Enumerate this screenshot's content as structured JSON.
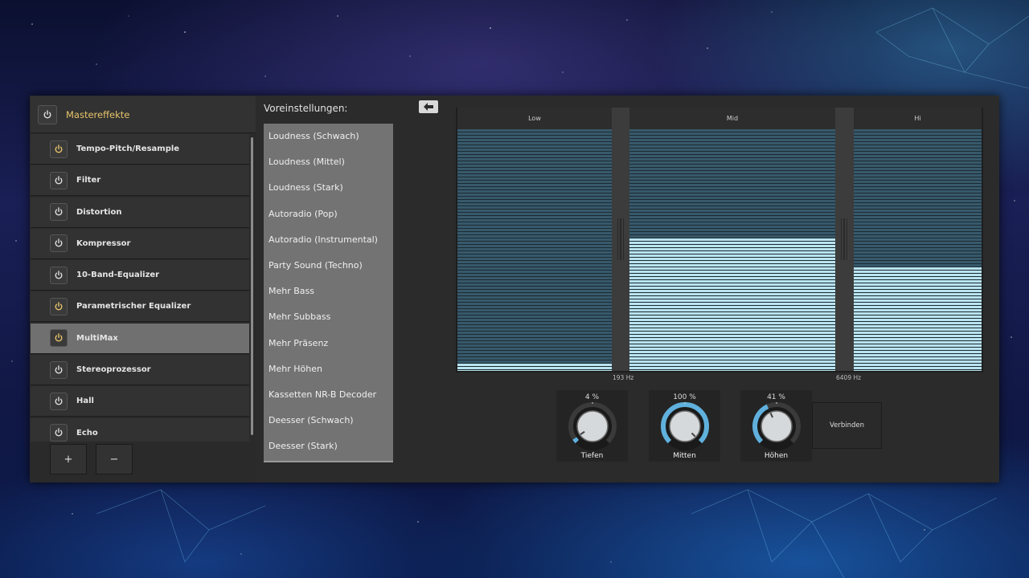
{
  "colors": {
    "accent": "#e7c46a",
    "band_active": "#b9e4f0",
    "band_inactive": "#37596b",
    "knob_ring": "#5fb0dd",
    "panel": "#2b2b2b"
  },
  "effects": {
    "title": "Mastereffekte",
    "items": [
      {
        "label": "Tempo-Pitch/Resample",
        "active": true,
        "selected": false
      },
      {
        "label": "Filter",
        "active": false,
        "selected": false
      },
      {
        "label": "Distortion",
        "active": false,
        "selected": false
      },
      {
        "label": "Kompressor",
        "active": false,
        "selected": false
      },
      {
        "label": "10-Band-Equalizer",
        "active": false,
        "selected": false
      },
      {
        "label": "Parametrischer Equalizer",
        "active": true,
        "selected": false
      },
      {
        "label": "MultiMax",
        "active": true,
        "selected": true
      },
      {
        "label": "Stereoprozessor",
        "active": false,
        "selected": false
      },
      {
        "label": "Hall",
        "active": false,
        "selected": false
      },
      {
        "label": "Echo",
        "active": false,
        "selected": false
      }
    ],
    "add_label": "+",
    "remove_label": "−"
  },
  "presets": {
    "title": "Voreinstellungen:",
    "items": [
      "Loudness (Schwach)",
      "Loudness (Mittel)",
      "Loudness (Stark)",
      "Autoradio (Pop)",
      "Autoradio (Instrumental)",
      "Party Sound (Techno)",
      "Mehr Bass",
      "Mehr Subbass",
      "Mehr Präsenz",
      "Mehr Höhen",
      "Kassetten NR-B Decoder",
      "Deesser (Schwach)",
      "Deesser (Stark)"
    ]
  },
  "multiband": {
    "bands": [
      {
        "label": "Low",
        "level": 0.04
      },
      {
        "label": "Mid",
        "level": 0.55
      },
      {
        "label": "Hi",
        "level": 0.43
      }
    ],
    "crossovers": [
      "193 Hz",
      "6409 Hz"
    ]
  },
  "knobs": [
    {
      "label": "Tiefen",
      "value_text": "4 %",
      "value": 0.04
    },
    {
      "label": "Mitten",
      "value_text": "100 %",
      "value": 1.0
    },
    {
      "label": "Höhen",
      "value_text": "41 %",
      "value": 0.41
    }
  ],
  "connect_label": "Verbinden"
}
